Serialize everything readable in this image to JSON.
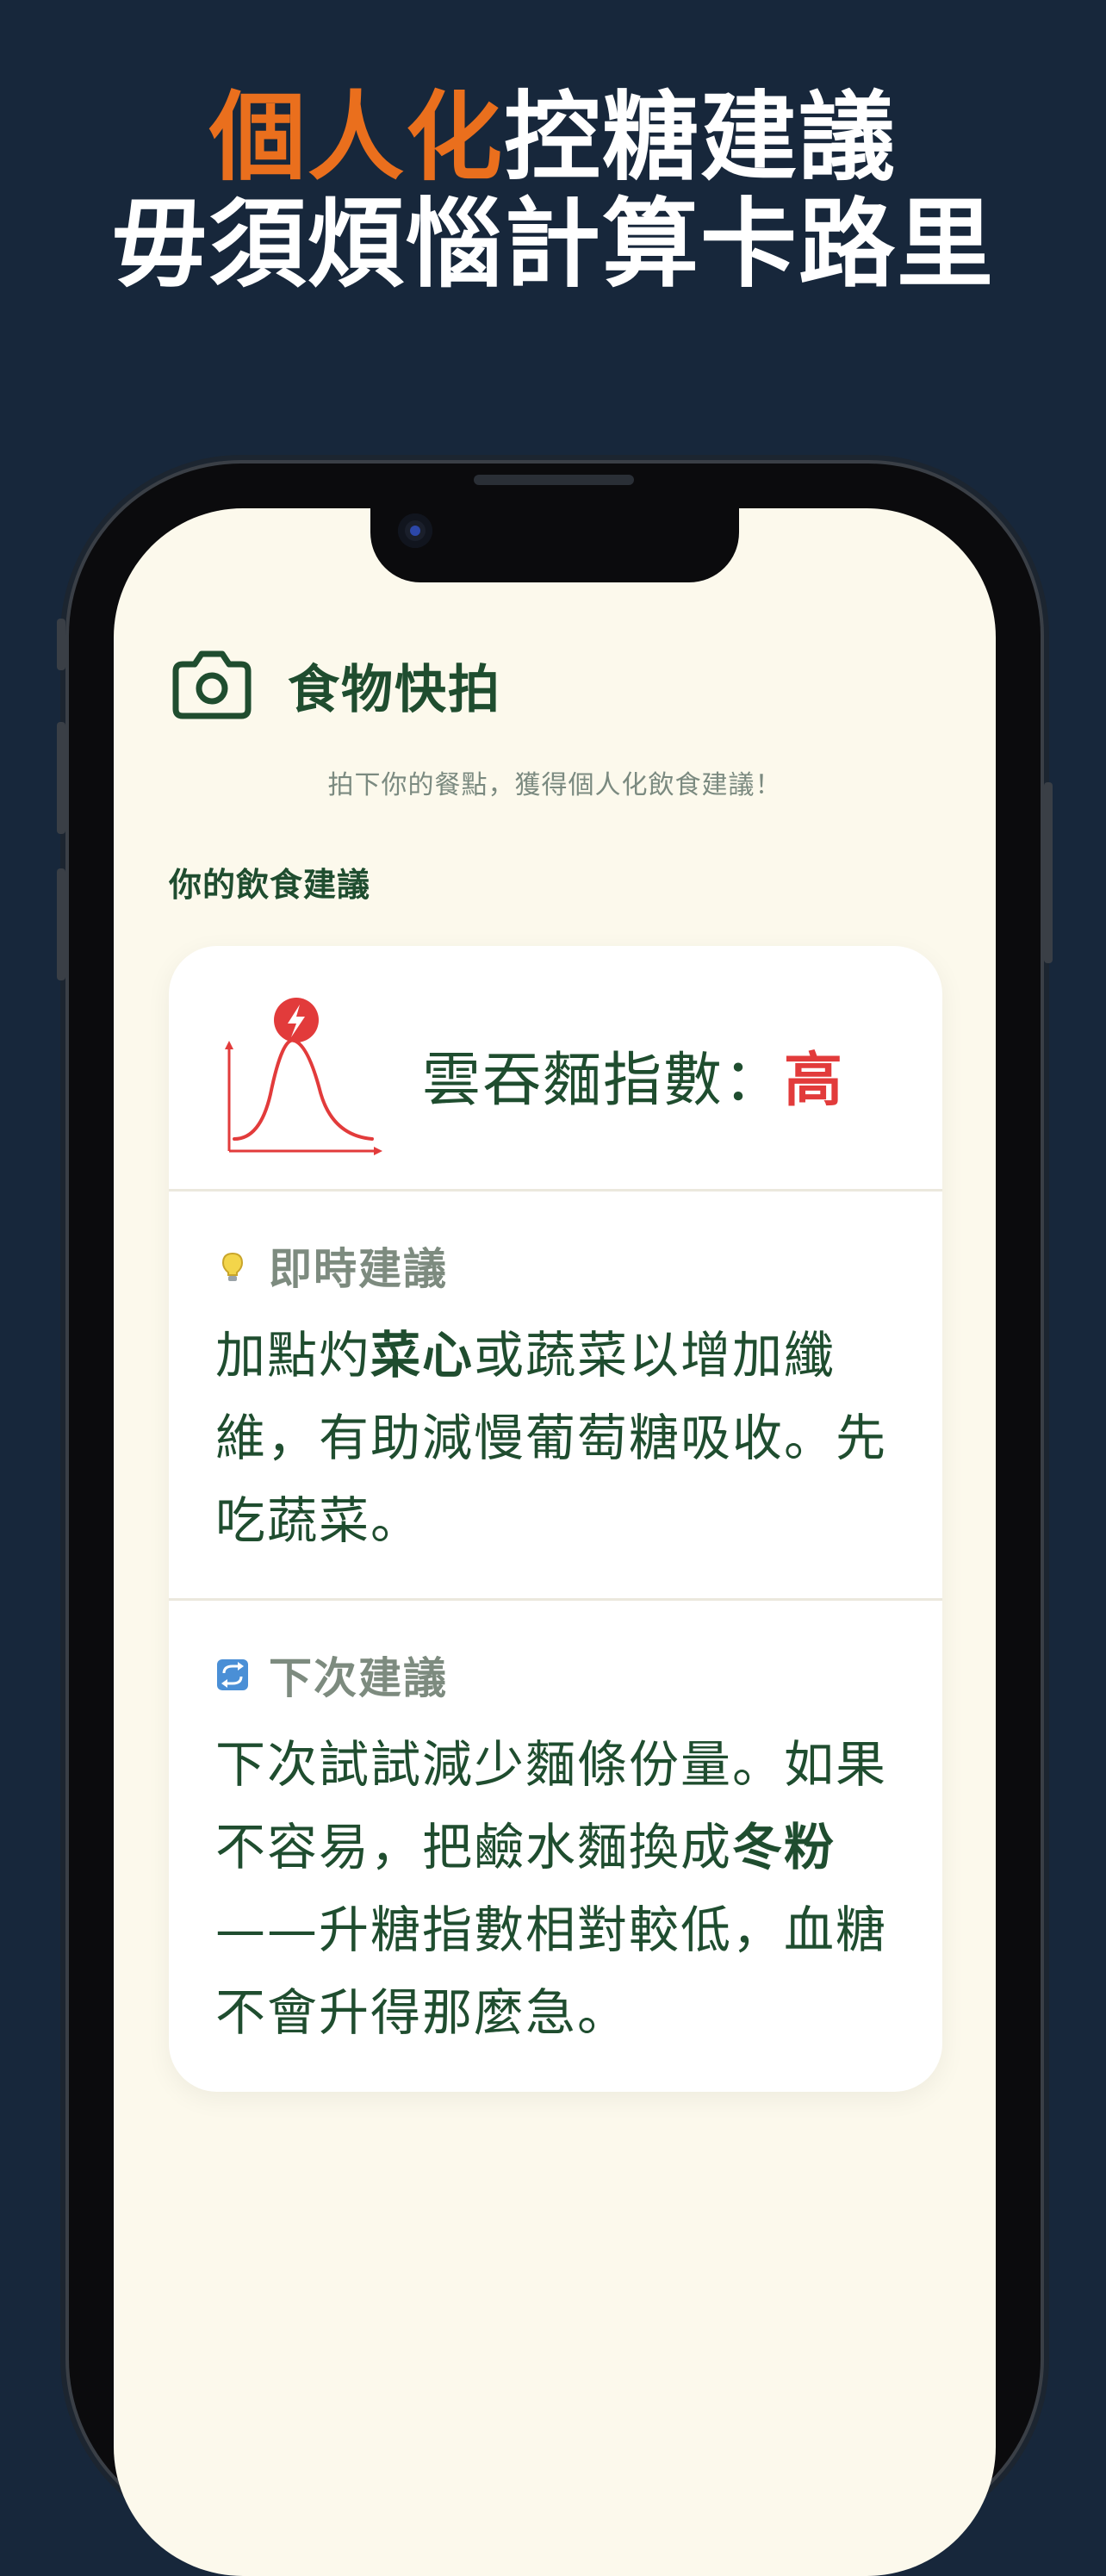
{
  "headline": {
    "line1_accent": "個人化",
    "line1_rest": "控糖建議",
    "line2": "毋須煩惱計算卡路里"
  },
  "app": {
    "title": "食物快拍",
    "subtitle": "拍下你的餐點，獲得個人化飲食建議！",
    "section_label": "你的飲食建議"
  },
  "card": {
    "index_label": "雲吞麵指數：",
    "index_level": "高",
    "index_color": "#e23b3b",
    "immediate": {
      "label": "即時建議",
      "icon": "lightbulb-icon",
      "seg1": "加點灼",
      "seg2": "菜心",
      "seg3": "或蔬菜以增加纖維，有助減慢葡萄糖吸收。先吃蔬菜。"
    },
    "next": {
      "label": "下次建議",
      "icon": "repeat-icon",
      "seg1": "下次試試減少麵條份量。如果不容易，把鹼水麵換成",
      "seg2": "冬粉",
      "seg3": "——升糖指數相對較低，血糖不會升得那麼急。"
    }
  },
  "colors": {
    "background": "#17273b",
    "accent": "#ea6f1d",
    "brand_green": "#1f4d2f",
    "screen_bg": "#fcf9ec"
  }
}
